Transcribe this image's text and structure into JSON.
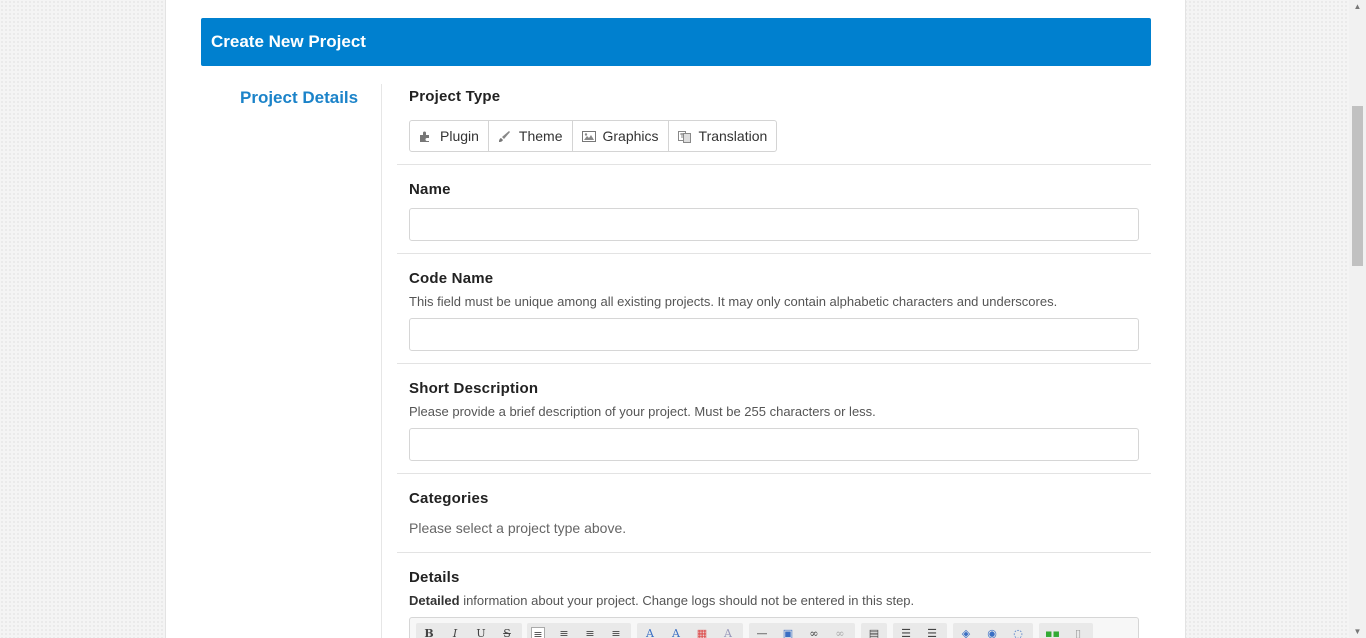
{
  "header": {
    "title": "Create New Project"
  },
  "sidebar": {
    "section_title": "Project Details"
  },
  "project_type": {
    "label": "Project Type",
    "options": [
      {
        "label": "Plugin",
        "icon": "puzzle-icon"
      },
      {
        "label": "Theme",
        "icon": "brush-icon"
      },
      {
        "label": "Graphics",
        "icon": "image-icon"
      },
      {
        "label": "Translation",
        "icon": "language-icon"
      }
    ]
  },
  "name": {
    "label": "Name",
    "value": ""
  },
  "code_name": {
    "label": "Code Name",
    "help": "This field must be unique among all existing projects. It may only contain alphabetic characters and underscores.",
    "value": ""
  },
  "short_description": {
    "label": "Short Description",
    "help": "Please provide a brief description of your project. Must be 255 characters or less.",
    "value": ""
  },
  "categories": {
    "label": "Categories",
    "placeholder": "Please select a project type above."
  },
  "details": {
    "label": "Details",
    "help_bold": "Detailed",
    "help_rest": " information about your project. Change logs should not be entered in this step."
  },
  "editor_toolbar": {
    "text_buttons": [
      "B",
      "I",
      "U",
      "S"
    ]
  }
}
